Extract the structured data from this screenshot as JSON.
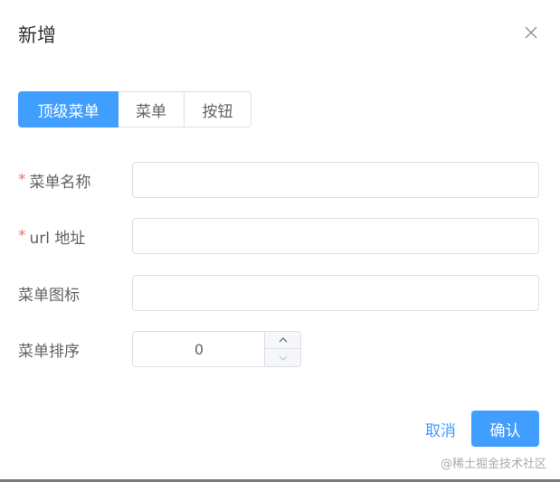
{
  "dialog": {
    "title": "新增",
    "close_icon": "close-icon"
  },
  "menu_type": {
    "options": [
      "顶级菜单",
      "菜单",
      "按钮"
    ],
    "selected": "顶级菜单"
  },
  "form": {
    "name": {
      "label": "菜单名称",
      "required_mark": "*",
      "value": ""
    },
    "url": {
      "label": "url 地址",
      "required_mark": "*",
      "value": ""
    },
    "icon": {
      "label": "菜单图标",
      "value": ""
    },
    "order": {
      "label": "菜单排序",
      "value": "0"
    }
  },
  "footer": {
    "cancel_label": "取消",
    "confirm_label": "确认"
  },
  "watermark": "@稀土掘金技术社区",
  "colors": {
    "primary": "#409eff",
    "required": "#f56c6c",
    "border": "#dcdfe6"
  }
}
